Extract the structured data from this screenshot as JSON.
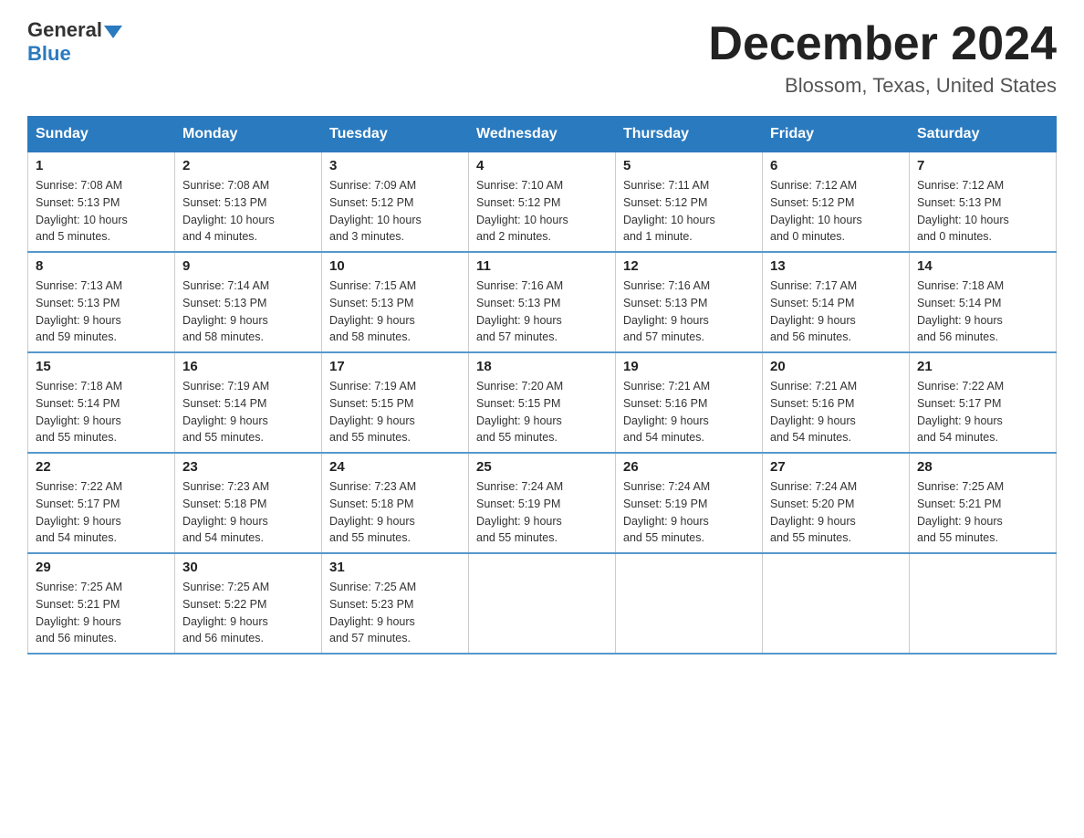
{
  "header": {
    "logo_general": "General",
    "logo_blue": "Blue",
    "title": "December 2024",
    "subtitle": "Blossom, Texas, United States"
  },
  "days_of_week": [
    "Sunday",
    "Monday",
    "Tuesday",
    "Wednesday",
    "Thursday",
    "Friday",
    "Saturday"
  ],
  "weeks": [
    [
      {
        "num": "1",
        "info": "Sunrise: 7:08 AM\nSunset: 5:13 PM\nDaylight: 10 hours\nand 5 minutes."
      },
      {
        "num": "2",
        "info": "Sunrise: 7:08 AM\nSunset: 5:13 PM\nDaylight: 10 hours\nand 4 minutes."
      },
      {
        "num": "3",
        "info": "Sunrise: 7:09 AM\nSunset: 5:12 PM\nDaylight: 10 hours\nand 3 minutes."
      },
      {
        "num": "4",
        "info": "Sunrise: 7:10 AM\nSunset: 5:12 PM\nDaylight: 10 hours\nand 2 minutes."
      },
      {
        "num": "5",
        "info": "Sunrise: 7:11 AM\nSunset: 5:12 PM\nDaylight: 10 hours\nand 1 minute."
      },
      {
        "num": "6",
        "info": "Sunrise: 7:12 AM\nSunset: 5:12 PM\nDaylight: 10 hours\nand 0 minutes."
      },
      {
        "num": "7",
        "info": "Sunrise: 7:12 AM\nSunset: 5:13 PM\nDaylight: 10 hours\nand 0 minutes."
      }
    ],
    [
      {
        "num": "8",
        "info": "Sunrise: 7:13 AM\nSunset: 5:13 PM\nDaylight: 9 hours\nand 59 minutes."
      },
      {
        "num": "9",
        "info": "Sunrise: 7:14 AM\nSunset: 5:13 PM\nDaylight: 9 hours\nand 58 minutes."
      },
      {
        "num": "10",
        "info": "Sunrise: 7:15 AM\nSunset: 5:13 PM\nDaylight: 9 hours\nand 58 minutes."
      },
      {
        "num": "11",
        "info": "Sunrise: 7:16 AM\nSunset: 5:13 PM\nDaylight: 9 hours\nand 57 minutes."
      },
      {
        "num": "12",
        "info": "Sunrise: 7:16 AM\nSunset: 5:13 PM\nDaylight: 9 hours\nand 57 minutes."
      },
      {
        "num": "13",
        "info": "Sunrise: 7:17 AM\nSunset: 5:14 PM\nDaylight: 9 hours\nand 56 minutes."
      },
      {
        "num": "14",
        "info": "Sunrise: 7:18 AM\nSunset: 5:14 PM\nDaylight: 9 hours\nand 56 minutes."
      }
    ],
    [
      {
        "num": "15",
        "info": "Sunrise: 7:18 AM\nSunset: 5:14 PM\nDaylight: 9 hours\nand 55 minutes."
      },
      {
        "num": "16",
        "info": "Sunrise: 7:19 AM\nSunset: 5:14 PM\nDaylight: 9 hours\nand 55 minutes."
      },
      {
        "num": "17",
        "info": "Sunrise: 7:19 AM\nSunset: 5:15 PM\nDaylight: 9 hours\nand 55 minutes."
      },
      {
        "num": "18",
        "info": "Sunrise: 7:20 AM\nSunset: 5:15 PM\nDaylight: 9 hours\nand 55 minutes."
      },
      {
        "num": "19",
        "info": "Sunrise: 7:21 AM\nSunset: 5:16 PM\nDaylight: 9 hours\nand 54 minutes."
      },
      {
        "num": "20",
        "info": "Sunrise: 7:21 AM\nSunset: 5:16 PM\nDaylight: 9 hours\nand 54 minutes."
      },
      {
        "num": "21",
        "info": "Sunrise: 7:22 AM\nSunset: 5:17 PM\nDaylight: 9 hours\nand 54 minutes."
      }
    ],
    [
      {
        "num": "22",
        "info": "Sunrise: 7:22 AM\nSunset: 5:17 PM\nDaylight: 9 hours\nand 54 minutes."
      },
      {
        "num": "23",
        "info": "Sunrise: 7:23 AM\nSunset: 5:18 PM\nDaylight: 9 hours\nand 54 minutes."
      },
      {
        "num": "24",
        "info": "Sunrise: 7:23 AM\nSunset: 5:18 PM\nDaylight: 9 hours\nand 55 minutes."
      },
      {
        "num": "25",
        "info": "Sunrise: 7:24 AM\nSunset: 5:19 PM\nDaylight: 9 hours\nand 55 minutes."
      },
      {
        "num": "26",
        "info": "Sunrise: 7:24 AM\nSunset: 5:19 PM\nDaylight: 9 hours\nand 55 minutes."
      },
      {
        "num": "27",
        "info": "Sunrise: 7:24 AM\nSunset: 5:20 PM\nDaylight: 9 hours\nand 55 minutes."
      },
      {
        "num": "28",
        "info": "Sunrise: 7:25 AM\nSunset: 5:21 PM\nDaylight: 9 hours\nand 55 minutes."
      }
    ],
    [
      {
        "num": "29",
        "info": "Sunrise: 7:25 AM\nSunset: 5:21 PM\nDaylight: 9 hours\nand 56 minutes."
      },
      {
        "num": "30",
        "info": "Sunrise: 7:25 AM\nSunset: 5:22 PM\nDaylight: 9 hours\nand 56 minutes."
      },
      {
        "num": "31",
        "info": "Sunrise: 7:25 AM\nSunset: 5:23 PM\nDaylight: 9 hours\nand 57 minutes."
      },
      {
        "num": "",
        "info": ""
      },
      {
        "num": "",
        "info": ""
      },
      {
        "num": "",
        "info": ""
      },
      {
        "num": "",
        "info": ""
      }
    ]
  ]
}
